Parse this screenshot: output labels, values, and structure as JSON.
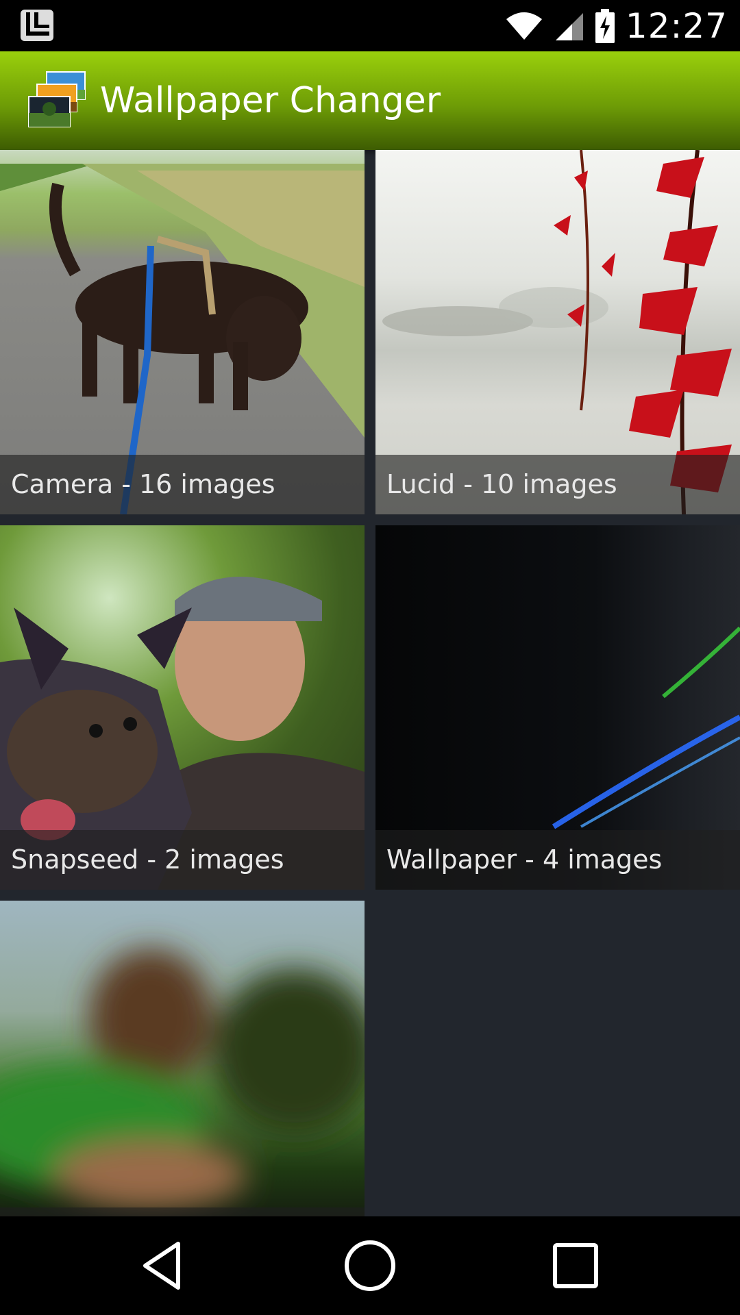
{
  "status_bar": {
    "time": "12:27",
    "left_icon": "launcher-notification-icon",
    "icons": [
      "wifi-icon",
      "signal-icon",
      "battery-charging-icon"
    ]
  },
  "app_bar": {
    "title": "Wallpaper Changer",
    "logo_icon": "stacked-photos-logo"
  },
  "albums": [
    {
      "caption": "Camera - 16 images",
      "thumbnail": "dog-on-road"
    },
    {
      "caption": "Lucid - 10 images",
      "thumbnail": "misty-lake-red-leaves"
    },
    {
      "caption": "Snapseed - 2 images",
      "thumbnail": "man-with-dog-selfie"
    },
    {
      "caption": "Wallpaper - 4 images",
      "thumbnail": "dark-abstract-light-streaks"
    },
    {
      "caption": "",
      "thumbnail": "blurred-portrait"
    }
  ],
  "nav_bar": {
    "icons": [
      "back-icon",
      "home-icon",
      "recents-icon"
    ]
  }
}
